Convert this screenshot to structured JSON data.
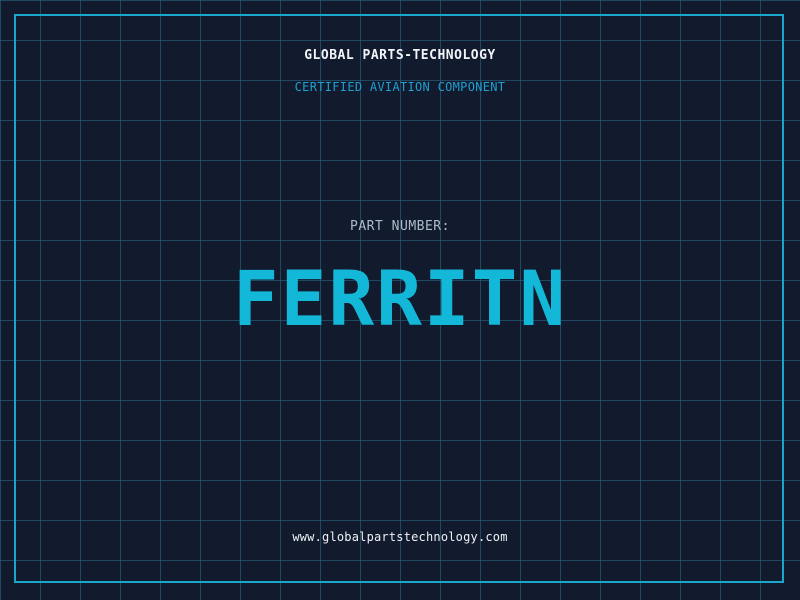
{
  "header": {
    "company": "GLOBAL PARTS-TECHNOLOGY",
    "tagline": "CERTIFIED AVIATION COMPONENT"
  },
  "part": {
    "label": "PART NUMBER:",
    "number": "FERRITN"
  },
  "footer": {
    "website": "www.globalpartstechnology.com"
  },
  "colors": {
    "background": "#121a2e",
    "grid": "#2c6e8c",
    "accent": "#13b8d8",
    "frame": "#19a6cf"
  }
}
